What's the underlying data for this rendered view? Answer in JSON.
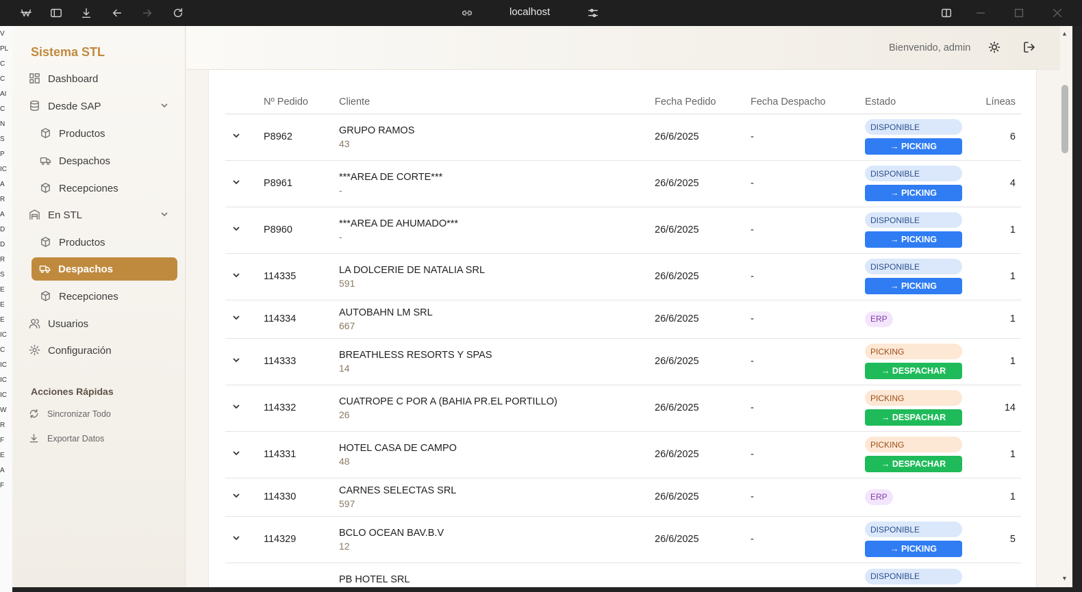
{
  "browser": {
    "url": "localhost"
  },
  "left_strip": [
    "V",
    "PL",
    "C",
    "C",
    "AI",
    "C",
    "N",
    "S",
    "P",
    "IC",
    "A",
    "R",
    "A",
    "D",
    "D",
    "R",
    "S",
    "E",
    "E",
    "E",
    "IC",
    "C",
    "IC",
    "IC",
    "IC",
    "W",
    "R",
    "F",
    "E",
    "A",
    "F"
  ],
  "sidebar": {
    "brand": "Sistema STL",
    "items": [
      {
        "label": "Dashboard",
        "icon": "grid-icon"
      },
      {
        "label": "Desde SAP",
        "icon": "database-icon",
        "expandable": true
      },
      {
        "label": "Productos",
        "icon": "box-icon"
      },
      {
        "label": "Despachos",
        "icon": "truck-icon"
      },
      {
        "label": "Recepciones",
        "icon": "box-icon"
      },
      {
        "label": "En STL",
        "icon": "warehouse-icon",
        "expandable": true
      },
      {
        "label": "Productos",
        "icon": "box-icon"
      },
      {
        "label": "Despachos",
        "icon": "truck-icon",
        "active": true
      },
      {
        "label": "Recepciones",
        "icon": "box-icon"
      },
      {
        "label": "Usuarios",
        "icon": "users-icon"
      },
      {
        "label": "Configuración",
        "icon": "gear-icon"
      }
    ],
    "quick_actions": {
      "title": "Acciones Rápidas",
      "items": [
        {
          "label": "Sincronizar Todo",
          "icon": "refresh-icon"
        },
        {
          "label": "Exportar Datos",
          "icon": "download-icon"
        }
      ]
    }
  },
  "header": {
    "welcome": "Bienvenido, admin"
  },
  "table": {
    "headers": [
      "Nº Pedido",
      "Cliente",
      "Fecha Pedido",
      "Fecha Despacho",
      "Estado",
      "Líneas"
    ],
    "rows": [
      {
        "pedido": "P8962",
        "cliente": "GRUPO RAMOS",
        "codigo": "43",
        "fecha": "26/6/2025",
        "despacho": "-",
        "estado": "DISPONIBLE",
        "accion": "→ PICKING",
        "lineas": "6"
      },
      {
        "pedido": "P8961",
        "cliente": "***AREA DE CORTE***",
        "codigo": "-",
        "fecha": "26/6/2025",
        "despacho": "-",
        "estado": "DISPONIBLE",
        "accion": "→ PICKING",
        "lineas": "4"
      },
      {
        "pedido": "P8960",
        "cliente": "***AREA DE AHUMADO***",
        "codigo": "-",
        "fecha": "26/6/2025",
        "despacho": "-",
        "estado": "DISPONIBLE",
        "accion": "→ PICKING",
        "lineas": "1"
      },
      {
        "pedido": "114335",
        "cliente": "LA DOLCERIE DE NATALIA SRL",
        "codigo": "591",
        "fecha": "26/6/2025",
        "despacho": "-",
        "estado": "DISPONIBLE",
        "accion": "→ PICKING",
        "lineas": "1"
      },
      {
        "pedido": "114334",
        "cliente": "AUTOBAHN LM SRL",
        "codigo": "667",
        "fecha": "26/6/2025",
        "despacho": "-",
        "estado": "ERP",
        "accion": "",
        "lineas": "1"
      },
      {
        "pedido": "114333",
        "cliente": "BREATHLESS RESORTS Y SPAS",
        "codigo": "14",
        "fecha": "26/6/2025",
        "despacho": "-",
        "estado": "PICKING",
        "accion": "→ DESPACHAR",
        "lineas": "1"
      },
      {
        "pedido": "114332",
        "cliente": "CUATROPE C POR A (BAHIA PR.EL PORTILLO)",
        "codigo": "26",
        "fecha": "26/6/2025",
        "despacho": "-",
        "estado": "PICKING",
        "accion": "→ DESPACHAR",
        "lineas": "14"
      },
      {
        "pedido": "114331",
        "cliente": "HOTEL CASA DE CAMPO",
        "codigo": "48",
        "fecha": "26/6/2025",
        "despacho": "-",
        "estado": "PICKING",
        "accion": "→ DESPACHAR",
        "lineas": "1"
      },
      {
        "pedido": "114330",
        "cliente": "CARNES SELECTAS SRL",
        "codigo": "597",
        "fecha": "26/6/2025",
        "despacho": "-",
        "estado": "ERP",
        "accion": "",
        "lineas": "1"
      },
      {
        "pedido": "114329",
        "cliente": "BCLO OCEAN BAV.B.V",
        "codigo": "12",
        "fecha": "26/6/2025",
        "despacho": "-",
        "estado": "DISPONIBLE",
        "accion": "→ PICKING",
        "lineas": "5"
      },
      {
        "pedido": "",
        "cliente": "PB HOTEL SRL",
        "codigo": "",
        "fecha": "",
        "despacho": "",
        "estado": "DISPONIBLE",
        "accion": "",
        "lineas": ""
      }
    ]
  },
  "colors": {
    "accent": "#c08a3e",
    "picking_button": "#2f7cf3",
    "despachar_button": "#1fbb5a"
  }
}
